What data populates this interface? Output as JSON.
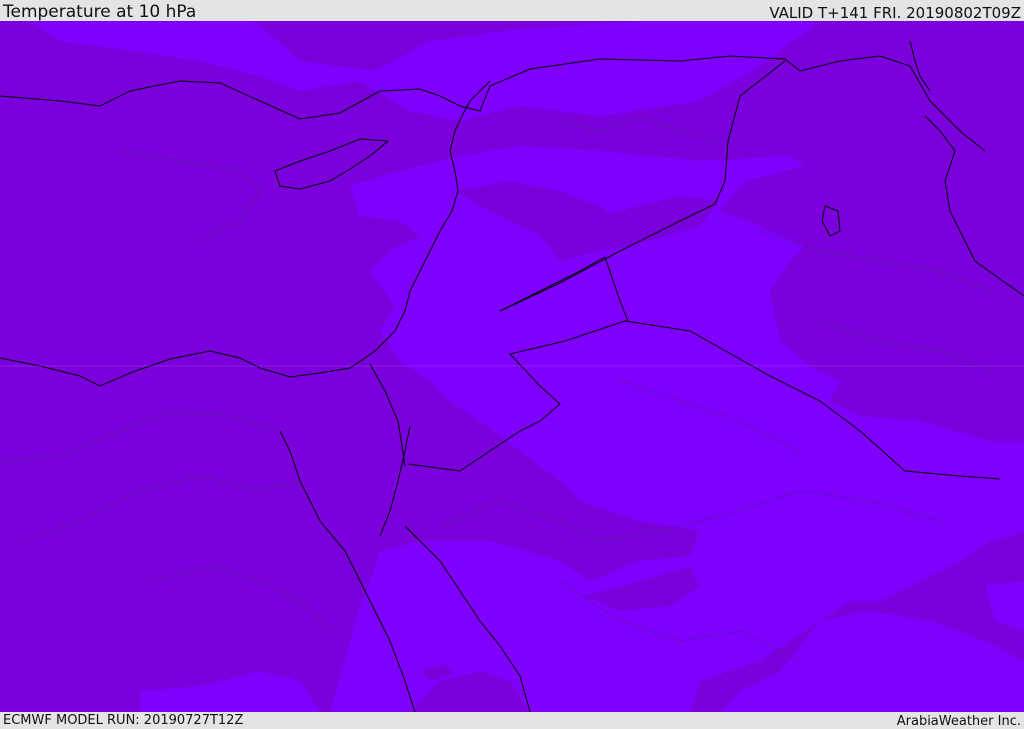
{
  "header": {
    "title": "Temperature at 10 hPa",
    "valid": "VALID T+141 FRI. 20190802T09Z"
  },
  "footer": {
    "model_run": "ECMWF MODEL RUN: 20190727T12Z",
    "credit": "ArabiaWeather Inc."
  },
  "colors": {
    "background_band": "#7a00dc",
    "warmer_band": "#7f00ff",
    "outline": "#000000",
    "chrome": "#e4e4e4"
  }
}
